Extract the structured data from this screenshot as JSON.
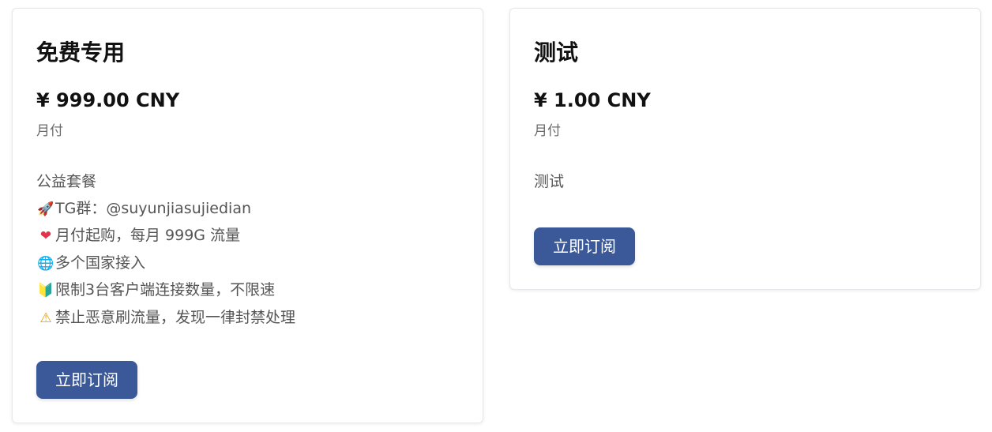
{
  "plans": [
    {
      "title": "免费专用",
      "price": "¥ 999.00 CNY",
      "period": "月付",
      "description": [
        {
          "icon": "rocket-icon",
          "glyph": "🚀",
          "text": "TG群：@suyunjiasujiedian"
        },
        {
          "icon": "heart-icon",
          "glyph": "❤",
          "text": "月付起购，每月 999G 流量"
        },
        {
          "icon": "globe-icon",
          "glyph": "🌐",
          "text": "多个国家接入"
        },
        {
          "icon": "beginner-icon",
          "glyph": "🔰",
          "text": "限制3台客户端连接数量，不限速"
        },
        {
          "icon": "warning-icon",
          "glyph": "⚠",
          "text": "禁止恶意刷流量，发现一律封禁处理"
        }
      ],
      "description_heading": "公益套餐",
      "button_label": "立即订阅"
    },
    {
      "title": "测试",
      "price": "¥ 1.00 CNY",
      "period": "月付",
      "description_heading": "测试",
      "button_label": "立即订阅"
    }
  ],
  "colors": {
    "button_bg": "#3b5998",
    "button_text": "#ffffff",
    "title_text": "#111111",
    "muted_text": "#6b6b6b"
  }
}
